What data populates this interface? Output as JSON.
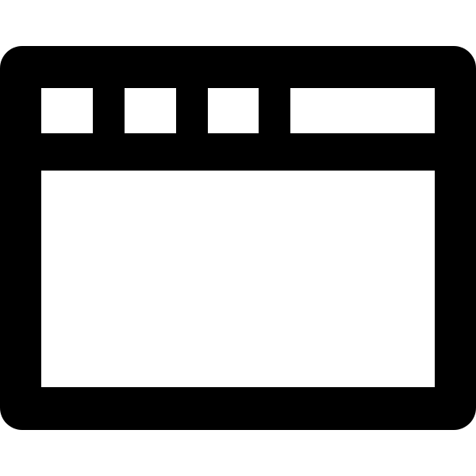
{
  "icon": {
    "name": "browser-window-icon",
    "foreground_color": "#000000",
    "background_color": "#ffffff",
    "titlebar_button_count": 3
  }
}
